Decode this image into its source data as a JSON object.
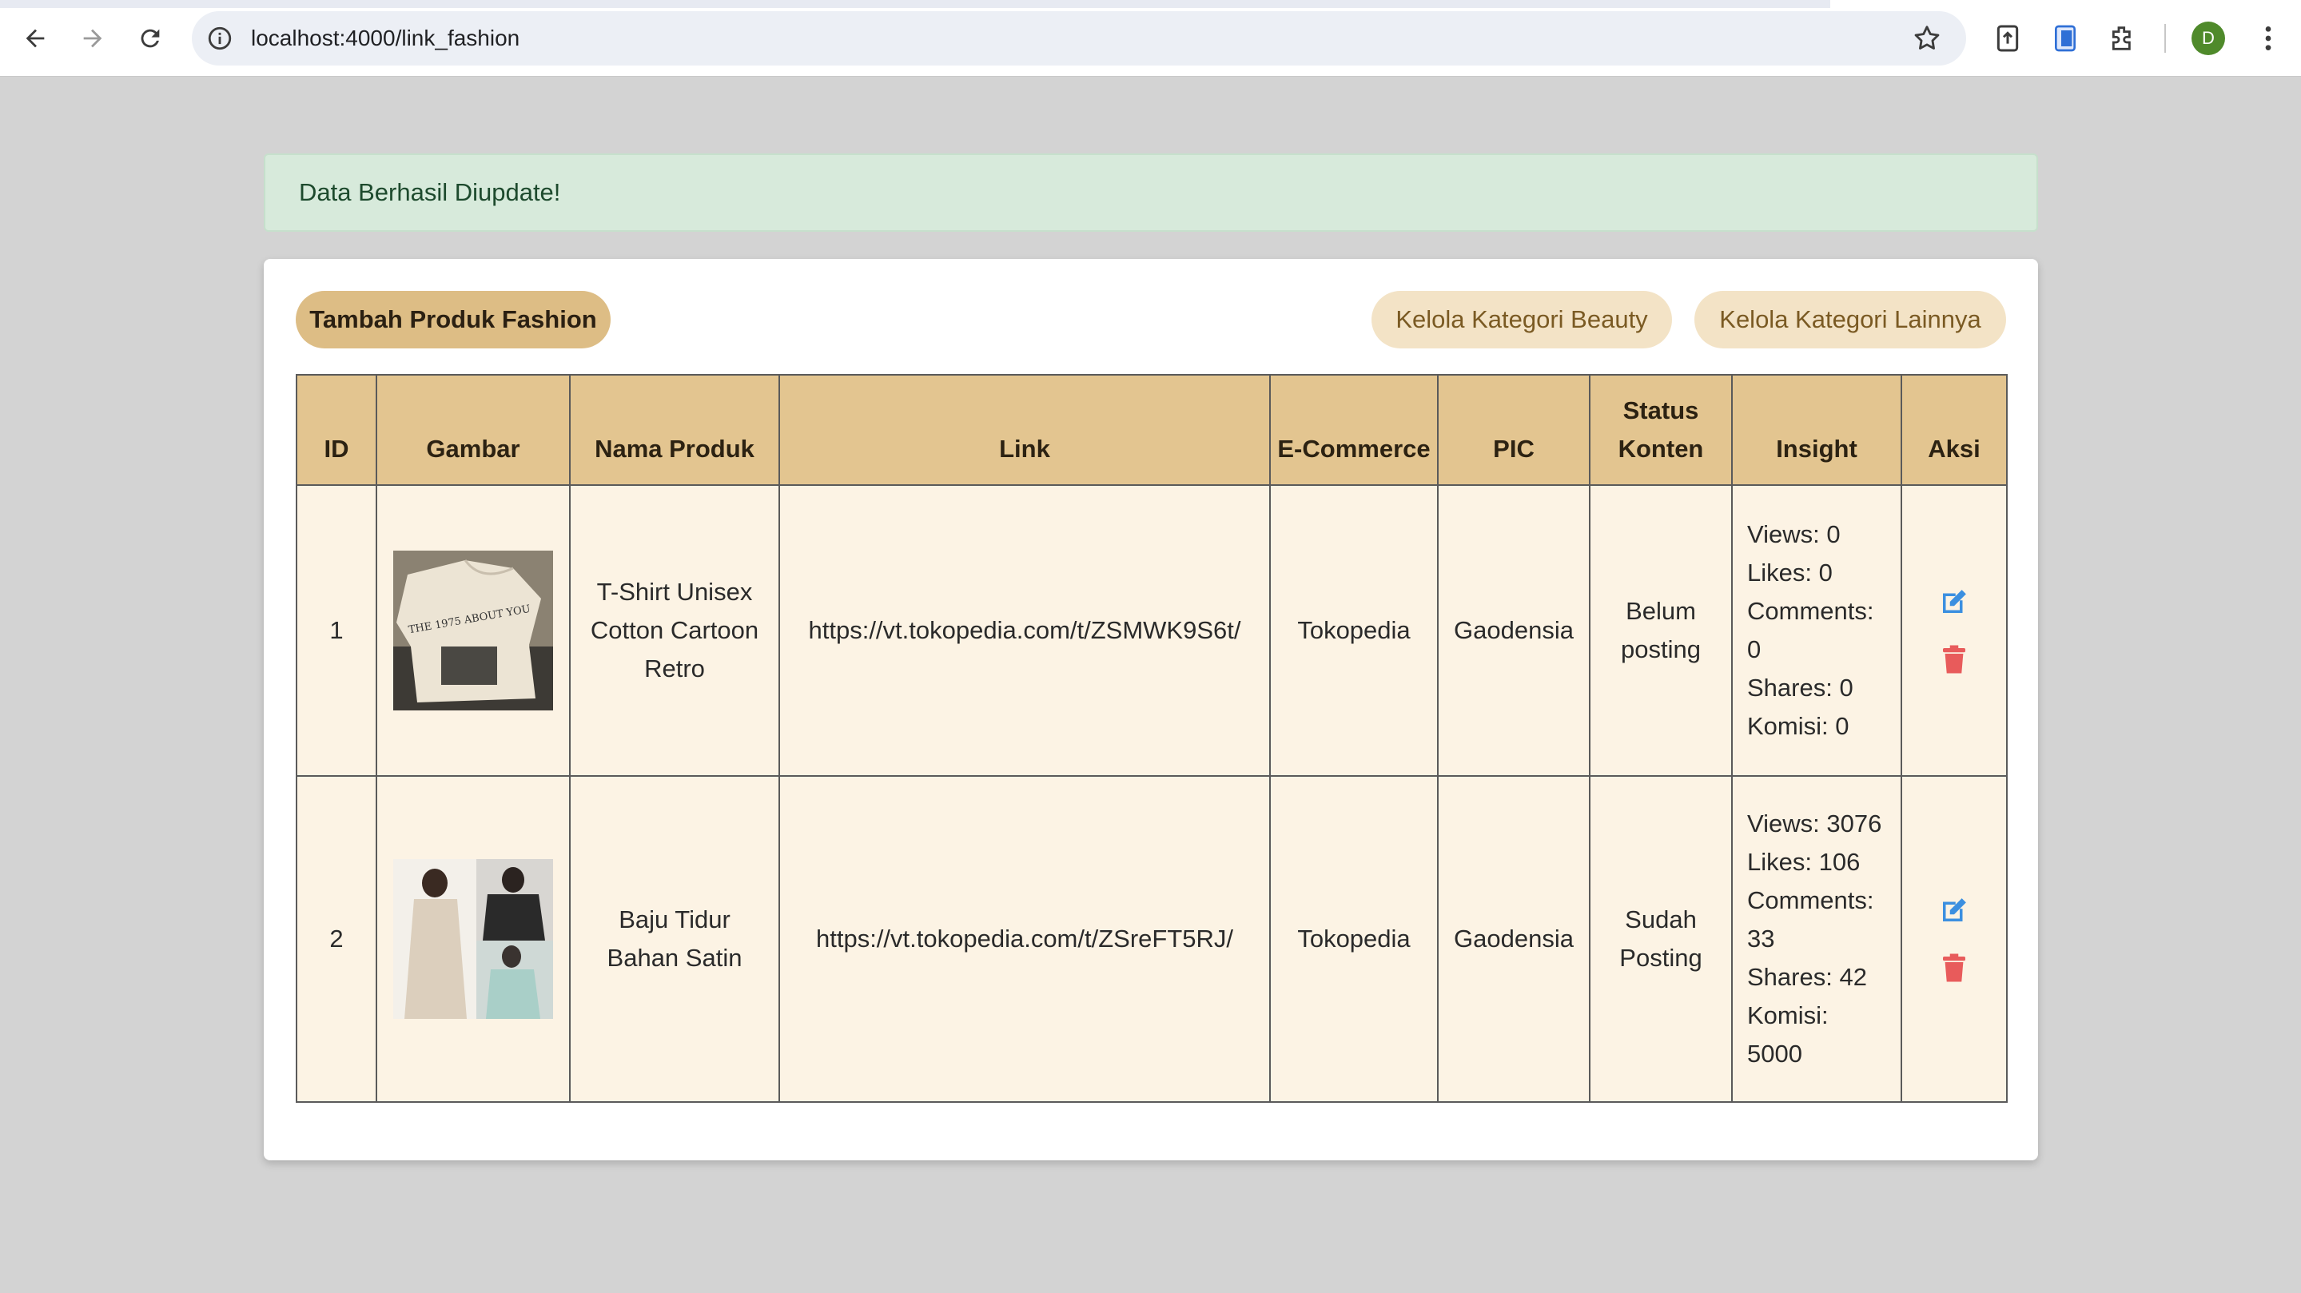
{
  "browser": {
    "url": "localhost:4000/link_fashion",
    "profile_initial": "D"
  },
  "alert": {
    "message": "Data Berhasil Diupdate!"
  },
  "toolbar": {
    "add_label": "Tambah Produk Fashion",
    "beauty_label": "Kelola Kategori Beauty",
    "other_label": "Kelola Kategori Lainnya"
  },
  "table": {
    "headers": {
      "id": "ID",
      "gambar": "Gambar",
      "nama": "Nama Produk",
      "link": "Link",
      "ecommerce": "E-Commerce",
      "pic": "PIC",
      "status": "Status Konten",
      "insight": "Insight",
      "aksi": "Aksi"
    },
    "rows": [
      {
        "id": "1",
        "nama": "T-Shirt Unisex Cotton Cartoon Retro",
        "link": "https://vt.tokopedia.com/t/ZSMWK9S6t/",
        "ecommerce": "Tokopedia",
        "pic": "Gaodensia",
        "status": "Belum posting",
        "views": "Views: 0",
        "likes": "Likes: 0",
        "comments": "Comments: 0",
        "shares": "Shares: 0",
        "komisi": "Komisi: 0",
        "image_text": "THE 1975 ABOUT YOU"
      },
      {
        "id": "2",
        "nama": "Baju Tidur Bahan Satin",
        "link": "https://vt.tokopedia.com/t/ZSreFT5RJ/",
        "ecommerce": "Tokopedia",
        "pic": "Gaodensia",
        "status": "Sudah Posting",
        "views": "Views: 3076",
        "likes": "Likes: 106",
        "comments": "Comments: 33",
        "shares": "Shares: 42",
        "komisi": "Komisi: 5000"
      }
    ]
  },
  "colors": {
    "header_bg": "#e3c590",
    "row_bg": "#fcf3e4",
    "primary_pill": "#ddbd85",
    "secondary_pill": "#f3e3c6",
    "alert_bg": "#d7eadb",
    "edit_icon": "#3b8fe0",
    "delete_icon": "#e85b5b"
  },
  "icons": [
    "back-icon",
    "forward-icon",
    "reload-icon",
    "info-icon",
    "star-icon",
    "extension-icon",
    "edit-icon",
    "trash-icon"
  ]
}
